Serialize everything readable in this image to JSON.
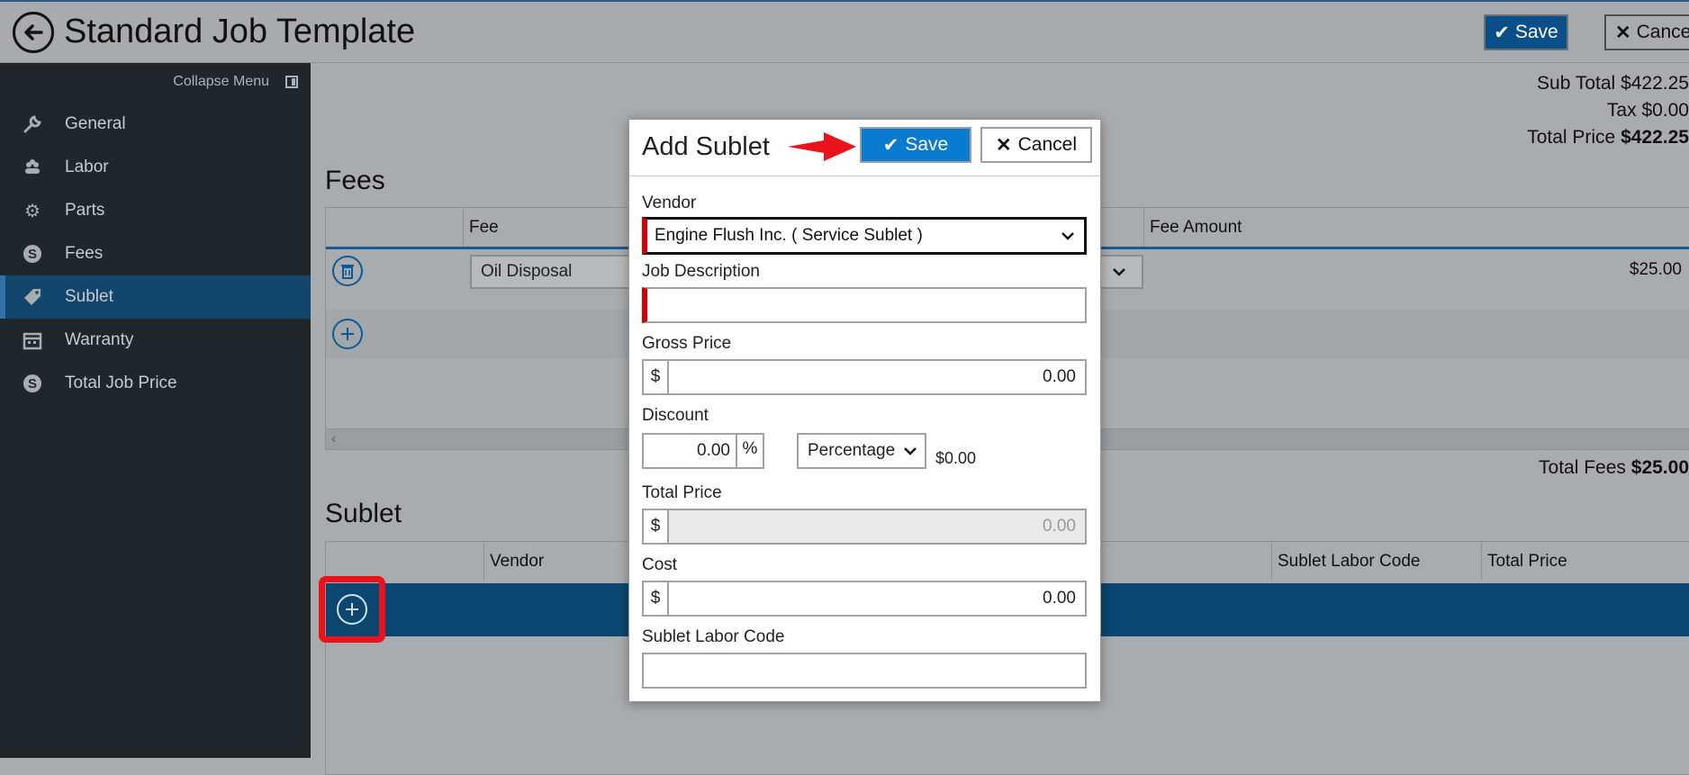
{
  "header": {
    "title": "Standard Job Template",
    "save_label": "Save",
    "cancel_label": "Cancel"
  },
  "sidebar": {
    "collapse_label": "Collapse Menu",
    "items": [
      {
        "label": "General",
        "icon": "wrench-icon"
      },
      {
        "label": "Labor",
        "icon": "labor-icon"
      },
      {
        "label": "Parts",
        "icon": "gear-icon"
      },
      {
        "label": "Fees",
        "icon": "dollar-circle-icon"
      },
      {
        "label": "Sublet",
        "icon": "tag-icon",
        "active": true
      },
      {
        "label": "Warranty",
        "icon": "calendar-icon"
      },
      {
        "label": "Total Job Price",
        "icon": "dollar-circle-icon"
      }
    ]
  },
  "totals": {
    "subtotal_label": "Sub Total",
    "subtotal_value": "$422.25",
    "tax_label": "Tax",
    "tax_value": "$0.00",
    "total_price_label": "Total Price",
    "total_price_value": "$422.25"
  },
  "fees": {
    "title": "Fees",
    "columns": [
      "Fee",
      "Fee Amount"
    ],
    "rows": [
      {
        "fee": "Oil Disposal",
        "amount": "$25.00"
      }
    ],
    "total_label": "Total Fees",
    "total_value": "$25.00"
  },
  "sublet": {
    "title": "Sublet",
    "columns": [
      "Vendor",
      "Sublet Labor Code",
      "Total Price"
    ]
  },
  "modal": {
    "title": "Add Sublet",
    "save_label": "Save",
    "cancel_label": "Cancel",
    "vendor_label": "Vendor",
    "vendor_value": "Engine Flush Inc. ( Service Sublet )",
    "job_description_label": "Job Description",
    "job_description_value": "",
    "gross_price_label": "Gross Price",
    "gross_price_value": "0.00",
    "discount_label": "Discount",
    "discount_value": "0.00",
    "discount_unit": "%",
    "discount_type": "Percentage",
    "discount_amount": "$0.00",
    "total_price_label": "Total Price",
    "total_price_value": "0.00",
    "cost_label": "Cost",
    "cost_value": "0.00",
    "sublet_labor_code_label": "Sublet Labor Code",
    "sublet_labor_code_value": "",
    "currency_symbol": "$"
  },
  "colors": {
    "accent": "#0b7ad1",
    "sidebar_bg": "#1f262c",
    "active_row": "#0b4770",
    "highlight_red": "#e8131b"
  }
}
